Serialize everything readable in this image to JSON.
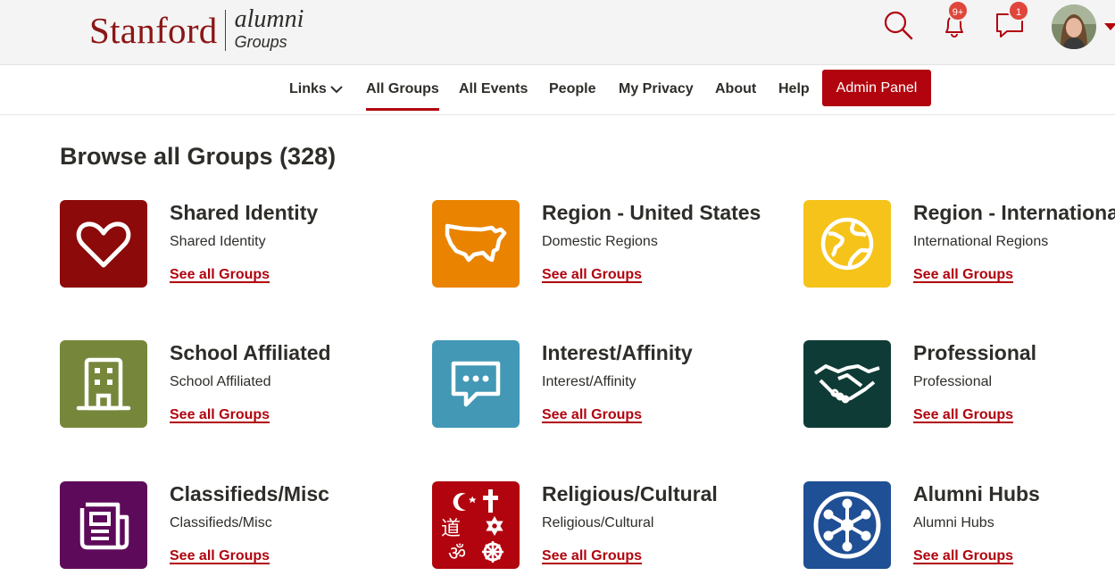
{
  "header": {
    "logo_main": "Stanford",
    "logo_alumni": "alumni",
    "logo_groups": "Groups",
    "notifications_badge": "9+",
    "messages_badge": "1"
  },
  "nav": {
    "items": [
      {
        "label": "Links"
      },
      {
        "label": "All Groups"
      },
      {
        "label": "All Events"
      },
      {
        "label": "People"
      },
      {
        "label": "My Privacy"
      },
      {
        "label": "About"
      },
      {
        "label": "Help"
      }
    ],
    "admin_label": "Admin Panel"
  },
  "main": {
    "title": "Browse all Groups (328)",
    "categories": [
      {
        "title": "Shared Identity",
        "subtitle": "Shared Identity",
        "link": "See all Groups",
        "icon": "heart-icon",
        "color": "#8c0a0a"
      },
      {
        "title": "Region - United States",
        "subtitle": "Domestic Regions",
        "link": "See all Groups",
        "icon": "usa-map-icon",
        "color": "#e98300"
      },
      {
        "title": "Region - International",
        "subtitle": "International Regions",
        "link": "See all Groups",
        "icon": "globe-icon",
        "color": "#f5c31a"
      },
      {
        "title": "School Affiliated",
        "subtitle": "School Affiliated",
        "link": "See all Groups",
        "icon": "building-icon",
        "color": "#76873b"
      },
      {
        "title": "Interest/Affinity",
        "subtitle": "Interest/Affinity",
        "link": "See all Groups",
        "icon": "chat-bubble-icon",
        "color": "#4298b5"
      },
      {
        "title": "Professional",
        "subtitle": "Professional",
        "link": "See all Groups",
        "icon": "handshake-icon",
        "color": "#0f3b36"
      },
      {
        "title": "Classifieds/Misc",
        "subtitle": "Classifieds/Misc",
        "link": "See all Groups",
        "icon": "newspaper-icon",
        "color": "#5e0a5a"
      },
      {
        "title": "Religious/Cultural",
        "subtitle": "Religious/Cultural",
        "link": "See all Groups",
        "icon": "religious-symbols-icon",
        "color": "#b1040e"
      },
      {
        "title": "Alumni Hubs",
        "subtitle": "Alumni Hubs",
        "link": "See all Groups",
        "icon": "hub-icon",
        "color": "#1f4f94"
      }
    ]
  },
  "colors": {
    "accent": "#b1040e",
    "logo_red": "#8c1515"
  }
}
